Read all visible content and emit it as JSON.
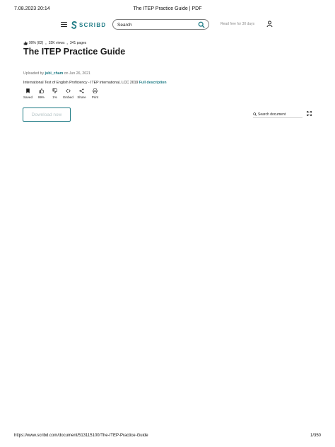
{
  "print_header": {
    "date": "7.08.2023 20:14",
    "title": "The ITEP Practice Guide | PDF"
  },
  "topbar": {
    "logo_text": "SCRIBD",
    "search_placeholder": "Search",
    "read_free": "Read free for 30 days",
    "brand_color": "#1e7b85"
  },
  "document": {
    "rating": "99% (82)",
    "views": "32K views",
    "pages": "341 pages",
    "title": "The ITEP Practice Guide",
    "uploaded_prefix": "Uploaded by",
    "uploader": "jubi_cham",
    "uploaded_suffix": "on Jun 26, 2021",
    "description": "International Test of English Proficiency - ITEP international, LCC 2019",
    "full_description_link": "Full description"
  },
  "actions": [
    {
      "label": "Saved",
      "icon": "bookmark-icon"
    },
    {
      "label": "99%",
      "icon": "thumbs-up-icon"
    },
    {
      "label": "1%",
      "icon": "thumbs-down-icon"
    },
    {
      "label": "Embed",
      "icon": "embed-icon"
    },
    {
      "label": "Share",
      "icon": "share-icon"
    },
    {
      "label": "Print",
      "icon": "print-icon"
    }
  ],
  "download_button": "Download now",
  "doc_search_placeholder": "Search document",
  "print_footer": {
    "url": "https://www.scribd.com/document/513115100/The-ITEP-Practice-Guide",
    "page": "1/350"
  }
}
